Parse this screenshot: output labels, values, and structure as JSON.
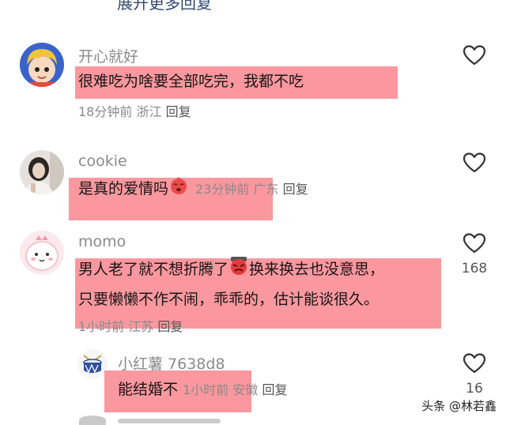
{
  "top": {
    "expand_more": "展开更多回复"
  },
  "comments": [
    {
      "username": "开心就好",
      "text": "很难吃为啥要全部吃完，我都不吃",
      "time": "18分钟前",
      "location": "浙江",
      "reply": "回复",
      "avatar_icon": "cartoon-boy-avatar"
    },
    {
      "username": "cookie",
      "text": "是真的爱情吗",
      "time": "23分钟前",
      "location": "广东",
      "reply": "回复",
      "emoji_icon": "red-blush-emoji",
      "avatar_icon": "girl-photo-avatar"
    },
    {
      "username": "momo",
      "text_line1": "男人老了就不想折腾了",
      "text_line1b": "换来换去也没意思，",
      "text_line2": "只要懒懒不作不闹，乖乖的，估计能谈很久。",
      "time": "1小时前",
      "location": "江苏",
      "reply": "回复",
      "likes": "168",
      "emoji_icon": "angry-red-emoji",
      "avatar_icon": "pink-dinosaur-avatar"
    }
  ],
  "reply": {
    "username": "小红薯 7638d8",
    "text": "能结婚不",
    "time": "1小时前",
    "location": "安徽",
    "reply": "回复",
    "likes": "16",
    "avatar_icon": "drum-avatar"
  },
  "watermark": "头条 @林若鑫",
  "colors": {
    "highlight": "#fa8089",
    "meta": "#8a8a8a",
    "link": "#304873"
  }
}
